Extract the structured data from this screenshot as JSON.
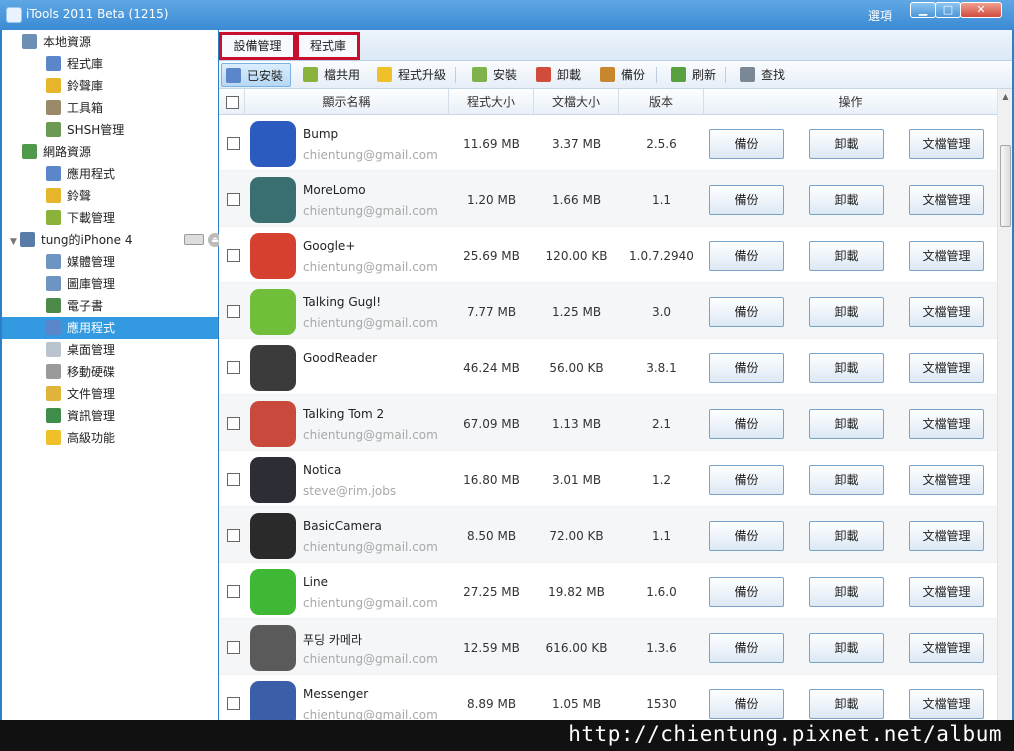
{
  "window": {
    "title": "iTools 2011 Beta (1215)",
    "options_label": "選項",
    "minimize": "▁",
    "maximize": "□",
    "close": "✕"
  },
  "sidebar": {
    "items": [
      {
        "label": "本地資源",
        "icon": "computer-icon",
        "color": "#6d8fb4"
      },
      {
        "label": "程式庫",
        "icon": "app-library-icon",
        "color": "#5b86c9"
      },
      {
        "label": "鈴聲庫",
        "icon": "bell-icon",
        "color": "#e7b52c"
      },
      {
        "label": "工具箱",
        "icon": "tools-icon",
        "color": "#9a8a6a"
      },
      {
        "label": "SHSH管理",
        "icon": "shsh-icon",
        "color": "#6b9a55"
      },
      {
        "label": "網路資源",
        "icon": "globe-icon",
        "color": "#4f9a4a"
      },
      {
        "label": "應用程式",
        "icon": "app-library-icon",
        "color": "#5b86c9"
      },
      {
        "label": "鈴聲",
        "icon": "bell-icon",
        "color": "#e7b52c"
      },
      {
        "label": "下載管理",
        "icon": "download-icon",
        "color": "#8bb23a"
      },
      {
        "label": "tung的iPhone 4",
        "icon": "iphone-icon",
        "color": "#5a7da8"
      },
      {
        "label": "媒體管理",
        "icon": "media-icon",
        "color": "#6e94c4"
      },
      {
        "label": "圖庫管理",
        "icon": "photo-icon",
        "color": "#6e94c4"
      },
      {
        "label": "電子書",
        "icon": "ebook-icon",
        "color": "#4d8a4a"
      },
      {
        "label": "應用程式",
        "icon": "app-library-icon",
        "color": "#5b86c9"
      },
      {
        "label": "桌面管理",
        "icon": "desktop-icon",
        "color": "#b9c4cf"
      },
      {
        "label": "移動硬碟",
        "icon": "disk-icon",
        "color": "#9a9a9a"
      },
      {
        "label": "文件管理",
        "icon": "folder-icon",
        "color": "#e0b43a"
      },
      {
        "label": "資訊管理",
        "icon": "contact-icon",
        "color": "#3f8d4b"
      },
      {
        "label": "高級功能",
        "icon": "star-icon",
        "color": "#efc02a"
      }
    ]
  },
  "tabs": [
    {
      "label": "設備管理"
    },
    {
      "label": "程式庫"
    }
  ],
  "toolbar": {
    "items": [
      {
        "label": "已安裝",
        "icon": "installed-icon",
        "color": "#5b86c9"
      },
      {
        "label": "檔共用",
        "icon": "file-share-icon",
        "color": "#8bb23a"
      },
      {
        "label": "程式升級",
        "icon": "star-icon",
        "color": "#efc02a"
      },
      {
        "label": "安裝",
        "icon": "install-icon",
        "color": "#7fb24a"
      },
      {
        "label": "卸載",
        "icon": "uninstall-icon",
        "color": "#d24c3c"
      },
      {
        "label": "備份",
        "icon": "backup-icon",
        "color": "#c8862e"
      },
      {
        "label": "刷新",
        "icon": "refresh-icon",
        "color": "#58a040"
      },
      {
        "label": "查找",
        "icon": "search-icon",
        "color": "#7a8896"
      }
    ]
  },
  "table": {
    "columns": {
      "name": "顯示名稱",
      "size": "程式大小",
      "doc": "文檔大小",
      "version": "版本",
      "actions": "操作"
    },
    "buttons": {
      "backup": "備份",
      "uninstall": "卸載",
      "docs": "文檔管理"
    },
    "rows": [
      {
        "name": "Bump",
        "account": "chientung@gmail.com",
        "size": "11.69 MB",
        "doc": "3.37 MB",
        "version": "2.5.6",
        "icon_color": "#2b5bbf",
        "icon": "bump-app-icon"
      },
      {
        "name": "MoreLomo",
        "account": "chientung@gmail.com",
        "size": "1.20 MB",
        "doc": "1.66 MB",
        "version": "1.1",
        "icon_color": "#3a6f72",
        "icon": "camera-app-icon"
      },
      {
        "name": "Google+",
        "account": "chientung@gmail.com",
        "size": "25.69 MB",
        "doc": "120.00 KB",
        "version": "1.0.7.2940",
        "icon_color": "#d6412f",
        "icon": "google-plus-app-icon"
      },
      {
        "name": "Talking Gugl!",
        "account": "chientung@gmail.com",
        "size": "7.77 MB",
        "doc": "1.25 MB",
        "version": "3.0",
        "icon_color": "#6fbf3a",
        "icon": "gugl-app-icon"
      },
      {
        "name": "GoodReader",
        "account": "",
        "size": "46.24 MB",
        "doc": "56.00 KB",
        "version": "3.8.1",
        "icon_color": "#3b3b3b",
        "icon": "goodreader-app-icon"
      },
      {
        "name": "Talking Tom 2",
        "account": "chientung@gmail.com",
        "size": "67.09 MB",
        "doc": "1.13 MB",
        "version": "2.1",
        "icon_color": "#c94a3c",
        "icon": "talking-tom-app-icon"
      },
      {
        "name": "Notica",
        "account": "steve@rim.jobs",
        "size": "16.80 MB",
        "doc": "3.01 MB",
        "version": "1.2",
        "icon_color": "#2d2d36",
        "icon": "notica-app-icon"
      },
      {
        "name": "BasicCamera",
        "account": "chientung@gmail.com",
        "size": "8.50 MB",
        "doc": "72.00 KB",
        "version": "1.1",
        "icon_color": "#2a2a2a",
        "icon": "basic-camera-app-icon"
      },
      {
        "name": "Line",
        "account": "chientung@gmail.com",
        "size": "27.25 MB",
        "doc": "19.82 MB",
        "version": "1.6.0",
        "icon_color": "#3fb836",
        "icon": "line-app-icon"
      },
      {
        "name": "푸딩 카메라",
        "account": "chientung@gmail.com",
        "size": "12.59 MB",
        "doc": "616.00 KB",
        "version": "1.3.6",
        "icon_color": "#5a5a5a",
        "icon": "pudding-camera-app-icon"
      },
      {
        "name": "Messenger",
        "account": "chientung@gmail.com",
        "size": "8.89 MB",
        "doc": "1.05 MB",
        "version": "1530",
        "icon_color": "#3a5fa8",
        "icon": "messenger-app-icon"
      }
    ]
  },
  "watermark": "http://chientung.pixnet.net/album"
}
